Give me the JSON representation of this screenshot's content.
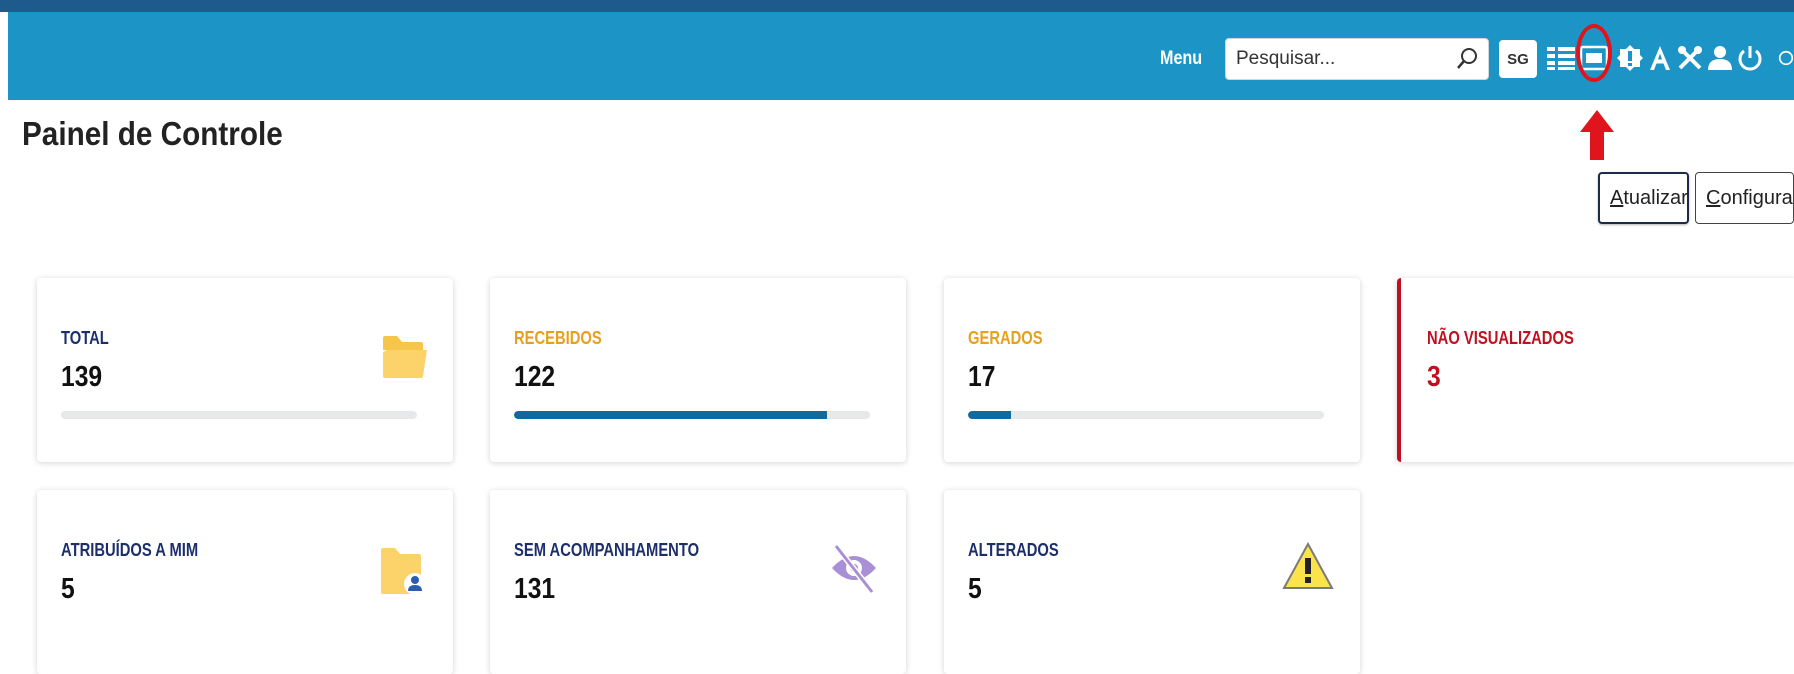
{
  "header": {
    "menu_label": "Menu",
    "search_placeholder": "Pesquisar...",
    "sg_label": "SG",
    "icons": [
      "list-icon",
      "calculator-123-icon",
      "alert-badge-icon",
      "font-size-icon",
      "tools-icon",
      "user-icon",
      "power-icon"
    ]
  },
  "page": {
    "title": "Painel de Controle",
    "update_button": {
      "underlined": "A",
      "rest": "tualizar"
    },
    "config_button": {
      "underlined": "C",
      "rest": "onfigurar"
    }
  },
  "colors": {
    "header": "#1c95c6",
    "navy_label": "#1d2f6b",
    "orange_label": "#e6a020",
    "red_label": "#c01020",
    "progress": "#0f6aa0",
    "highlight": "#e0141c"
  },
  "cards": [
    {
      "label": "TOTAL",
      "value": "139",
      "progress": 0,
      "icon": "folder-icon"
    },
    {
      "label": "RECEBIDOS",
      "value": "122",
      "progress": 0.88
    },
    {
      "label": "GERADOS",
      "value": "17",
      "progress": 0.12
    },
    {
      "label": "NÃO VISUALIZADOS",
      "value": "3"
    },
    {
      "label": "ATRIBUÍDOS A MIM",
      "value": "5",
      "icon": "folder-user-icon"
    },
    {
      "label": "SEM ACOMPANHAMENTO",
      "value": "131",
      "icon": "eye-slash-icon"
    },
    {
      "label": "ALTERADOS",
      "value": "5",
      "icon": "warning-icon"
    }
  ]
}
